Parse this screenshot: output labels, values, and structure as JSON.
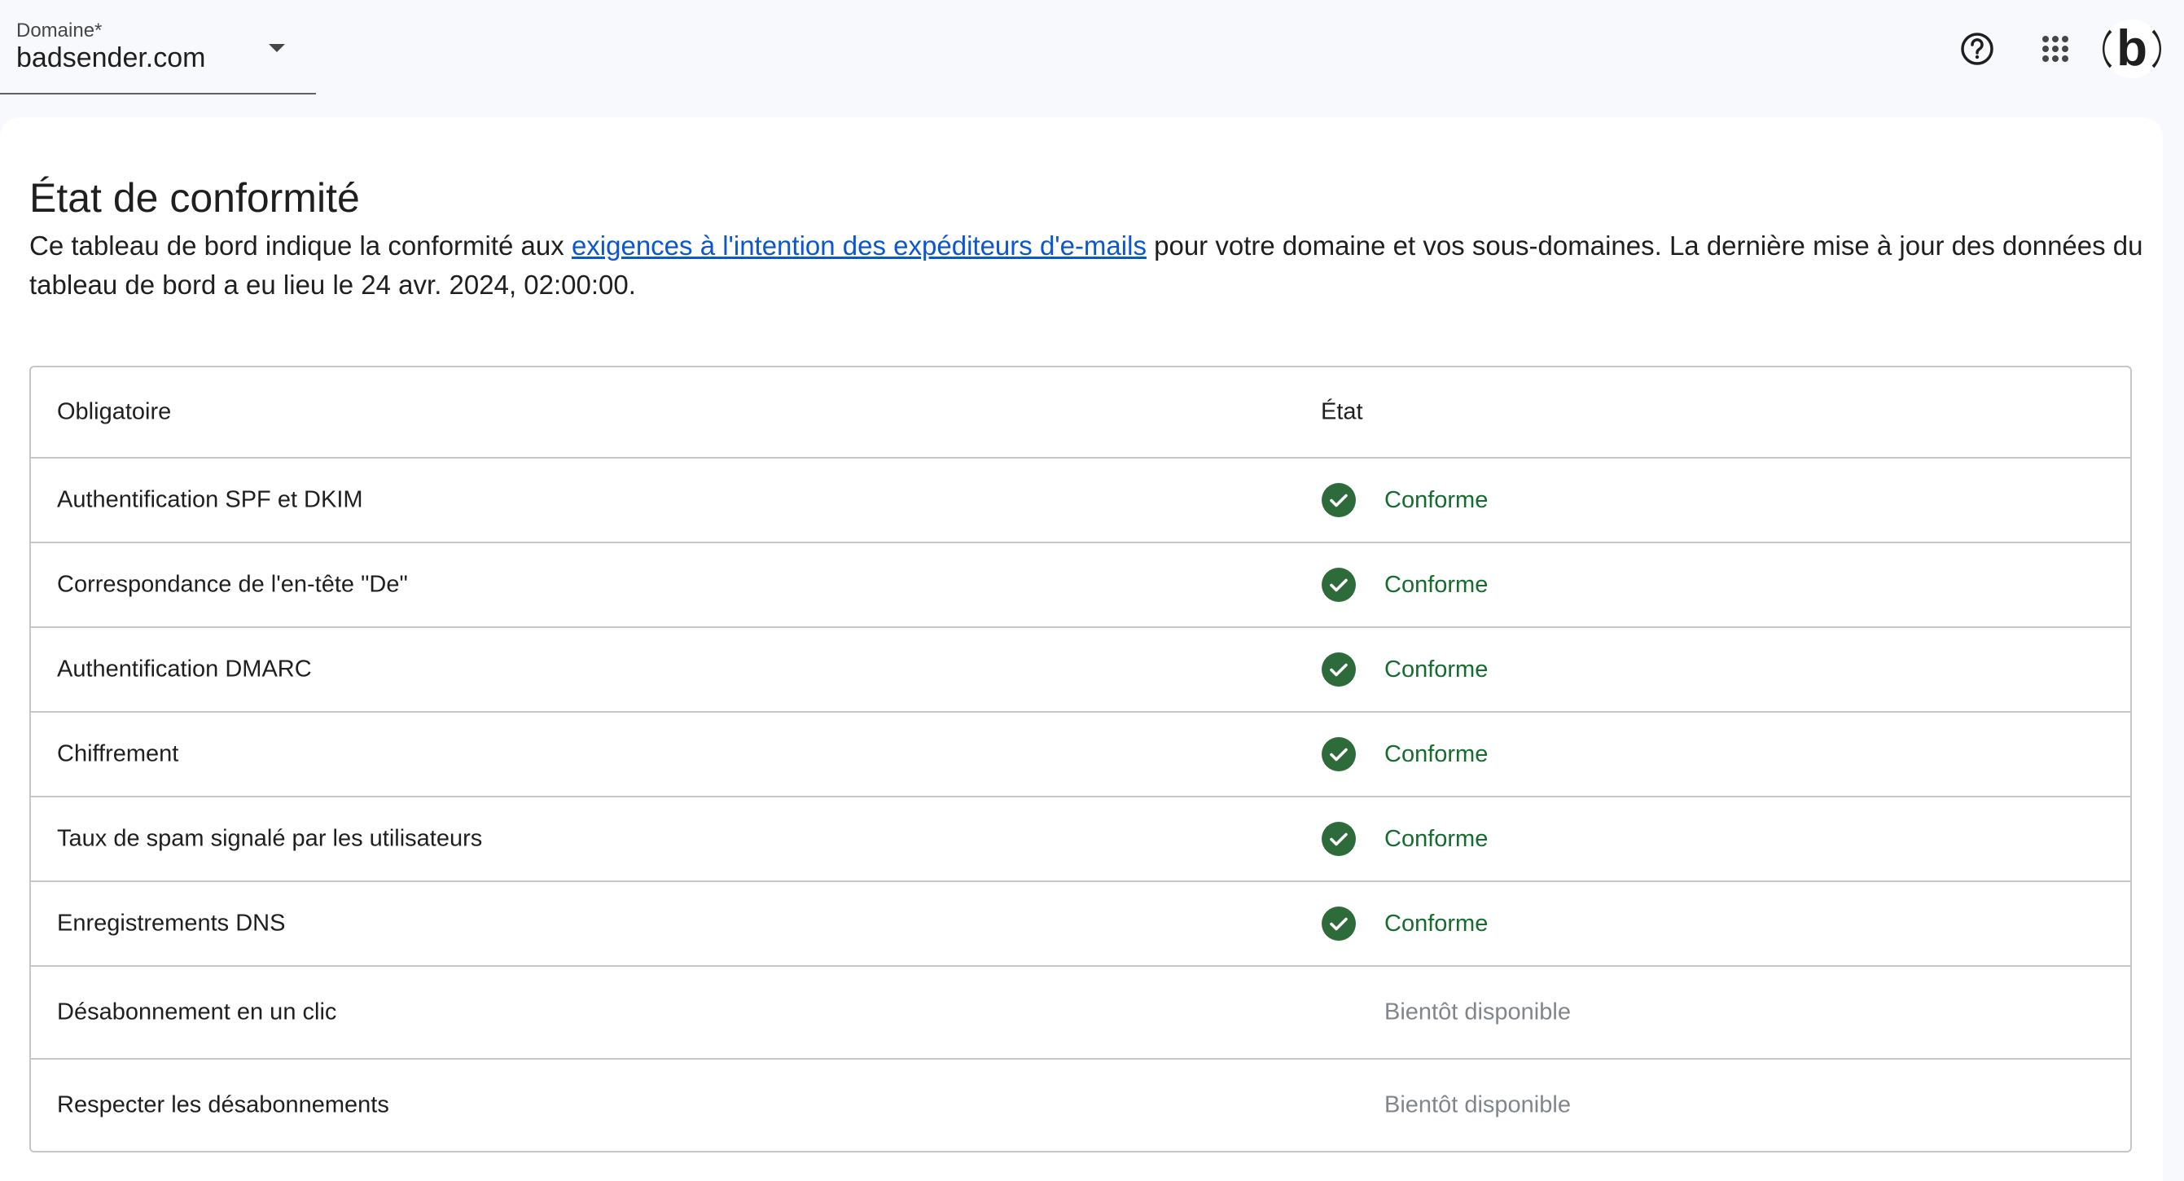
{
  "header": {
    "domain_label": "Domaine*",
    "domain_value": "badsender.com",
    "help_icon": "help-circle-icon",
    "apps_icon": "apps-grid-icon",
    "avatar_letter": "b"
  },
  "page": {
    "title": "État de conformité",
    "intro_before": "Ce tableau de bord indique la conformité aux ",
    "intro_link": "exigences à l'intention des expéditeurs d'e-mails",
    "intro_after": " pour votre domaine et vos sous-domaines. La dernière mise à jour des données du tableau de bord a eu lieu le 24 avr. 2024, 02:00:00."
  },
  "table": {
    "col_requirement": "Obligatoire",
    "col_status": "État",
    "rows": [
      {
        "requirement": "Authentification SPF et DKIM",
        "status": "Conforme"
      },
      {
        "requirement": "Correspondance de l'en-tête \"De\"",
        "status": "Conforme"
      },
      {
        "requirement": "Authentification DMARC",
        "status": "Conforme"
      },
      {
        "requirement": "Chiffrement",
        "status": "Conforme"
      },
      {
        "requirement": "Taux de spam signalé par les utilisateurs",
        "status": "Conforme"
      },
      {
        "requirement": "Enregistrements DNS",
        "status": "Conforme"
      },
      {
        "requirement": "Désabonnement en un clic",
        "status": "Bientôt disponible"
      },
      {
        "requirement": "Respecter les désabonnements",
        "status": "Bientôt disponible"
      }
    ]
  },
  "colors": {
    "compliant": "#146c2e",
    "compliant_icon": "#2e6b3a",
    "pending": "#80868b",
    "link": "#0b57d0"
  }
}
